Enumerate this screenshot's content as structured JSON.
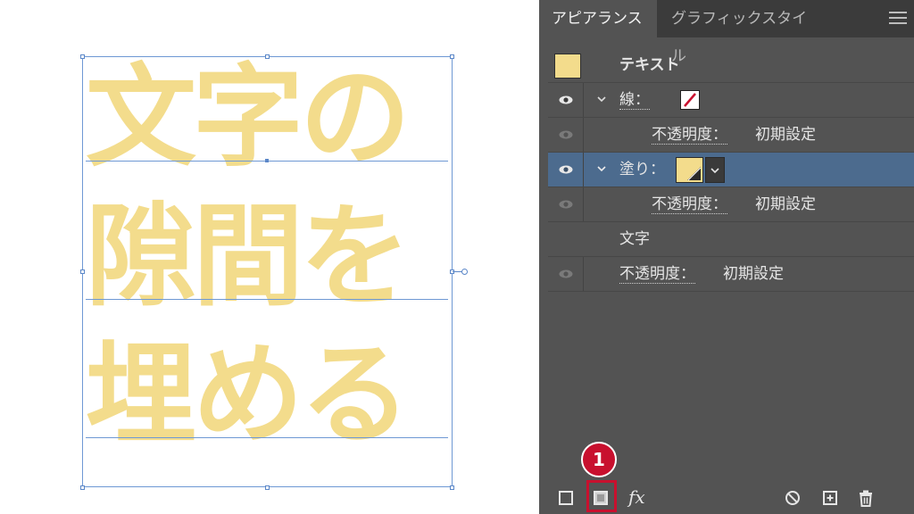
{
  "canvas": {
    "text_lines": [
      "文字の",
      "隙間を",
      "埋める"
    ],
    "text_color": "#f3dc8c",
    "selection_color": "#6e98d4"
  },
  "panel": {
    "tabs": [
      "アピアランス",
      "グラフィックスタイル"
    ],
    "menu_icon": "hamburger-menu-icon",
    "rows": {
      "text_label": "テキスト",
      "stroke_label": "線：",
      "stroke_opacity_label": "不透明度：",
      "stroke_opacity_value": "初期設定",
      "fill_label": "塗り：",
      "fill_opacity_label": "不透明度：",
      "fill_opacity_value": "初期設定",
      "characters_label": "文字",
      "opacity_label": "不透明度：",
      "opacity_value": "初期設定"
    },
    "colors": {
      "panel_bg": "#535353",
      "tab_bar_bg": "#3b3b3b",
      "selected_row": "#4c6b8e",
      "fill_swatch": "#f3dc8c",
      "stroke_none_slash": "#c8102e"
    },
    "bottom_icons": [
      "add-new-stroke-icon",
      "add-new-fill-icon",
      "fx-icon",
      "clear-appearance-icon",
      "duplicate-item-icon",
      "trash-icon"
    ],
    "fx_label": "fx"
  },
  "annotation": {
    "badge_number": "1",
    "badge_color": "#c8102e"
  }
}
